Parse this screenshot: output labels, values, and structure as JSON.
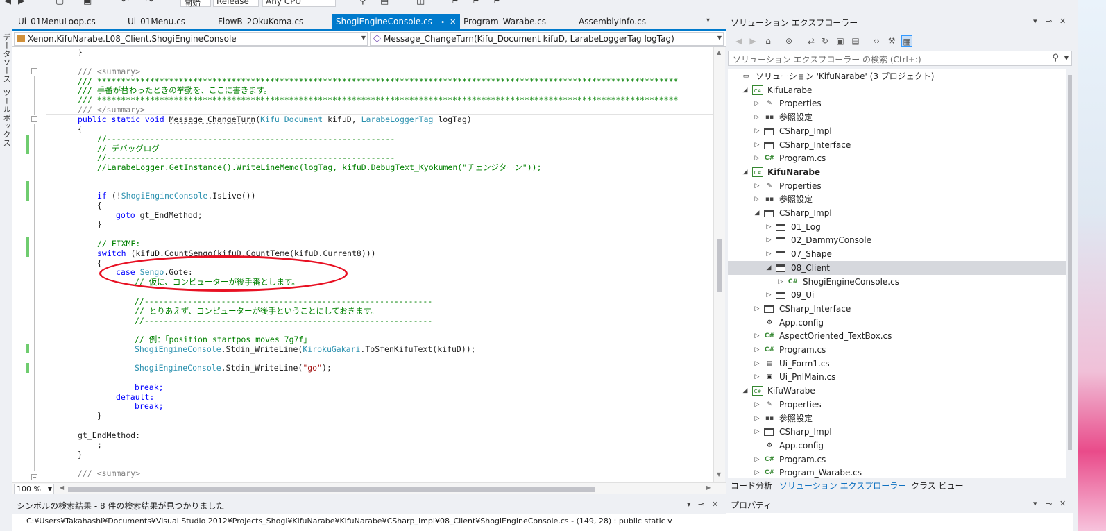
{
  "toolbar": {
    "config_label": "Release",
    "platform_label": "Any CPU",
    "start_label": "開始"
  },
  "side_tabs": [
    "データソース",
    "ツールボックス"
  ],
  "doc_tabs": [
    {
      "label": "Ui_01MenuLoop.cs"
    },
    {
      "label": "Ui_01Menu.cs"
    },
    {
      "label": "FlowB_2OkuKoma.cs"
    },
    {
      "label": "ShogiEngineConsole.cs",
      "active": true
    },
    {
      "label": "Program_Warabe.cs"
    },
    {
      "label": "AssemblyInfo.cs"
    }
  ],
  "navbar": {
    "class_combo": "Xenon.KifuNarabe.L08_Client.ShogiEngineConsole",
    "member_combo": "Message_ChangeTurn(Kifu_Document kifuD, LarabeLoggerTag logTag)"
  },
  "code": {
    "l01": "}",
    "l02": "/// <summary>",
    "l03": "/// *************************************************************************************************************************",
    "l04": "/// 手番が替わったときの挙動を、ここに書きます。",
    "l05": "/// *************************************************************************************************************************",
    "l06": "/// </summary>",
    "l07_kw": "public static void",
    "l07_name": "Message_ChangeTurn",
    "l07_t1": "Kifu_Document",
    "l07_a1": "kifuD,",
    "l07_t2": "LarabeLoggerTag",
    "l07_a2": "logTag)",
    "l08": "{",
    "l09": "//------------------------------------------------------------",
    "l10": "// デバッグログ",
    "l11": "//------------------------------------------------------------",
    "l12": "//LarabeLogger.GetInstance().WriteLineMemo(logTag, kifuD.DebugText_Kyokumen(\"チェンジターン\"));",
    "l13_kw": "if",
    "l13_a": "(!",
    "l13_t": "ShogiEngineConsole",
    "l13_b": ".IsLive())",
    "l14": "{",
    "l15_kw": "goto",
    "l15_a": "gt_EndMethod;",
    "l16": "}",
    "l17": "// FIXME:",
    "l18_kw": "switch",
    "l18_a": "(kifuD.CountSengo(kifuD.CountTeme(kifuD.Current8)))",
    "l19": "{",
    "l20_kw": "case",
    "l20_t": "Sengo",
    "l20_a": ".Gote:",
    "l21": "// 仮に、コンピューターが後手番とします。",
    "l22": "//------------------------------------------------------------",
    "l23": "// とりあえず、コンピューターが後手ということにしておきます。",
    "l24": "//------------------------------------------------------------",
    "l25": "// 例：「position startpos moves 7g7f」",
    "l26_t": "ShogiEngineConsole",
    "l26_a": ".Stdin_WriteLine(",
    "l26_t2": "KirokuGakari",
    "l26_b": ".ToSfenKifuText(kifuD));",
    "l27_t": "ShogiEngineConsole",
    "l27_a": ".Stdin_WriteLine(",
    "l27_s": "\"go\"",
    "l27_b": ");",
    "l28_kw": "break;",
    "l29_kw": "default:",
    "l30_kw": "break;",
    "l31": "}",
    "l32": "gt_EndMethod:",
    "l33": ";",
    "l34": "}",
    "l35": "/// <summary>"
  },
  "zoom": "100 %",
  "bottom_panel": {
    "title": "シンボルの検索結果 - 8 件の検索結果が見つかりました",
    "result": "C:¥Users¥Takahashi¥Documents¥Visual Studio 2012¥Projects_Shogi¥KifuNarabe¥KifuNarabe¥CSharp_Impl¥08_Client¥ShogiEngineConsole.cs - (149, 28) : public static v"
  },
  "solution_explorer": {
    "title": "ソリューション エクスプローラー",
    "search_placeholder": "ソリューション エクスプローラー の検索 (Ctrl+:)",
    "tree": [
      {
        "label": "ソリューション 'KifuNarabe' (3 プロジェクト)",
        "depth": 0,
        "icon": "solution-icon",
        "exp": ""
      },
      {
        "label": "KifuLarabe",
        "depth": 1,
        "icon": "csharp-project-icon",
        "exp": "open"
      },
      {
        "label": "Properties",
        "depth": 2,
        "icon": "wrench-icon",
        "exp": "closed"
      },
      {
        "label": "参照設定",
        "depth": 2,
        "icon": "references-icon",
        "exp": "closed"
      },
      {
        "label": "CSharp_Impl",
        "depth": 2,
        "icon": "folder-icon",
        "exp": "closed"
      },
      {
        "label": "CSharp_Interface",
        "depth": 2,
        "icon": "folder-icon",
        "exp": "closed"
      },
      {
        "label": "Program.cs",
        "depth": 2,
        "icon": "csharp-file-icon",
        "exp": "closed"
      },
      {
        "label": "KifuNarabe",
        "depth": 1,
        "icon": "csharp-project-icon",
        "exp": "open",
        "bold": true
      },
      {
        "label": "Properties",
        "depth": 2,
        "icon": "wrench-icon",
        "exp": "closed"
      },
      {
        "label": "参照設定",
        "depth": 2,
        "icon": "references-icon",
        "exp": "closed"
      },
      {
        "label": "CSharp_Impl",
        "depth": 2,
        "icon": "folder-icon",
        "exp": "open"
      },
      {
        "label": "01_Log",
        "depth": 3,
        "icon": "folder-icon",
        "exp": "closed"
      },
      {
        "label": "02_DammyConsole",
        "depth": 3,
        "icon": "folder-icon",
        "exp": "closed"
      },
      {
        "label": "07_Shape",
        "depth": 3,
        "icon": "folder-icon",
        "exp": "closed"
      },
      {
        "label": "08_Client",
        "depth": 3,
        "icon": "folder-icon",
        "exp": "open",
        "selected": true
      },
      {
        "label": "ShogiEngineConsole.cs",
        "depth": 4,
        "icon": "csharp-file-icon",
        "exp": "closed"
      },
      {
        "label": "09_Ui",
        "depth": 3,
        "icon": "folder-icon",
        "exp": "closed"
      },
      {
        "label": "CSharp_Interface",
        "depth": 2,
        "icon": "folder-icon",
        "exp": "closed"
      },
      {
        "label": "App.config",
        "depth": 2,
        "icon": "config-icon",
        "exp": ""
      },
      {
        "label": "AspectOriented_TextBox.cs",
        "depth": 2,
        "icon": "csharp-file-icon",
        "exp": "closed"
      },
      {
        "label": "Program.cs",
        "depth": 2,
        "icon": "csharp-file-icon",
        "exp": "closed"
      },
      {
        "label": "Ui_Form1.cs",
        "depth": 2,
        "icon": "form-icon",
        "exp": "closed"
      },
      {
        "label": "Ui_PnlMain.cs",
        "depth": 2,
        "icon": "usercontrol-icon",
        "exp": "closed"
      },
      {
        "label": "KifuWarabe",
        "depth": 1,
        "icon": "csharp-project-icon",
        "exp": "open"
      },
      {
        "label": "Properties",
        "depth": 2,
        "icon": "wrench-icon",
        "exp": "closed"
      },
      {
        "label": "参照設定",
        "depth": 2,
        "icon": "references-icon",
        "exp": "closed"
      },
      {
        "label": "CSharp_Impl",
        "depth": 2,
        "icon": "folder-icon",
        "exp": "closed"
      },
      {
        "label": "App.config",
        "depth": 2,
        "icon": "config-icon",
        "exp": ""
      },
      {
        "label": "Program.cs",
        "depth": 2,
        "icon": "csharp-file-icon",
        "exp": "closed"
      },
      {
        "label": "Program_Warabe.cs",
        "depth": 2,
        "icon": "csharp-file-icon",
        "exp": "closed"
      }
    ],
    "bottom_tabs": [
      {
        "label": "コード分析"
      },
      {
        "label": "ソリューション エクスプローラー",
        "active": true
      },
      {
        "label": "クラス ビュー"
      }
    ]
  },
  "properties_panel": {
    "title": "プロパティ"
  },
  "colors": {
    "accent": "#007acc",
    "change_bar": "#6fcc6f",
    "annotation_circle": "#e81123"
  }
}
